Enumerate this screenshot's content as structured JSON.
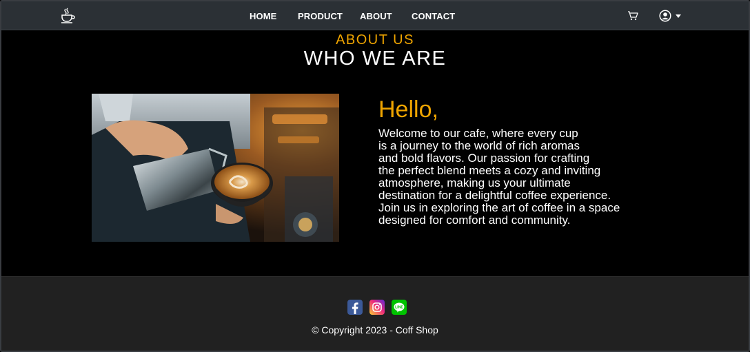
{
  "nav": {
    "links": [
      "HOME",
      "PRODUCT",
      "ABOUT",
      "CONTACT"
    ]
  },
  "about": {
    "eyebrow": "ABOUT US",
    "headline": "WHO WE ARE",
    "hello": "Hello,",
    "lines": [
      "Welcome to our cafe, where every cup",
      "is a journey to the world of rich aromas",
      "and bold flavors. Our passion for crafting",
      "the perfect blend meets a cozy and inviting",
      "atmosphere, making us your ultimate",
      "destination for a delightful coffee experience.",
      "Join us in exploring the art of coffee in a space",
      "designed for comfort and community."
    ]
  },
  "footer": {
    "copyright": "© Copyright 2023  - Coff Shop"
  },
  "colors": {
    "accent": "#f0a500",
    "navbar": "#2b3035",
    "footer": "#212121"
  }
}
